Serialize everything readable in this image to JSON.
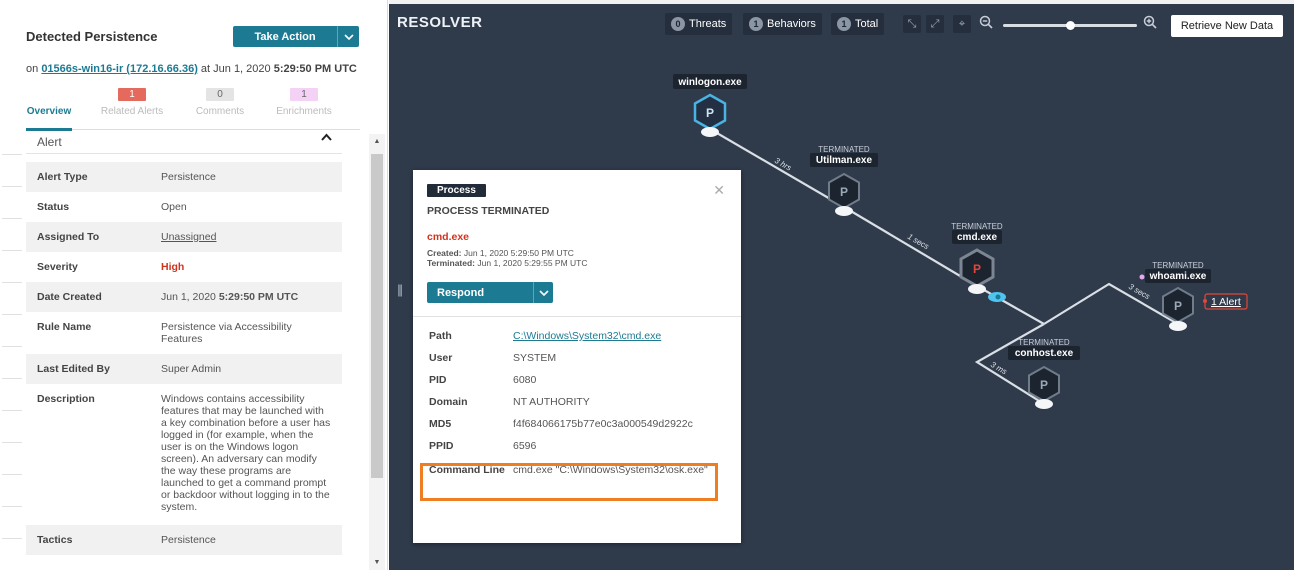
{
  "left_panel": {
    "title": "Detected Persistence",
    "take_action_label": "Take Action",
    "host_prefix": "on",
    "host_link": "01566s-win16-ir (172.16.66.36)",
    "host_at": "at Jun 1, 2020",
    "host_time": "5:29:50 PM UTC",
    "tabs": [
      {
        "label": "Overview",
        "badge": ""
      },
      {
        "label": "Related Alerts",
        "badge": "1"
      },
      {
        "label": "Comments",
        "badge": "0"
      },
      {
        "label": "Enrichments",
        "badge": "1"
      }
    ],
    "section_title": "Alert",
    "fields": {
      "alert_type": {
        "k": "Alert Type",
        "v": "Persistence"
      },
      "status": {
        "k": "Status",
        "v": "Open"
      },
      "assigned_to": {
        "k": "Assigned To",
        "v": "Unassigned"
      },
      "severity": {
        "k": "Severity",
        "v": "High"
      },
      "date_created": {
        "k": "Date Created",
        "v_date": "Jun 1, 2020",
        "v_time": "5:29:50 PM UTC"
      },
      "rule_name": {
        "k": "Rule Name",
        "v": "Persistence via Accessibility Features"
      },
      "last_edited_by": {
        "k": "Last Edited By",
        "v": "Super Admin"
      },
      "description": {
        "k": "Description",
        "v": "Windows contains accessibility features that may be launched with a key combination before a user has logged in (for example, when the user is on the Windows logon screen). An adversary can modify the way these programs are launched to get a command prompt or backdoor without logging in to the system."
      },
      "tactics": {
        "k": "Tactics",
        "v": "Persistence"
      }
    }
  },
  "toolbar": {
    "logo": "RESOLVER",
    "threats": {
      "count": "0",
      "label": "Threats"
    },
    "behaviors": {
      "count": "1",
      "label": "Behaviors"
    },
    "total": {
      "count": "1",
      "label": "Total"
    },
    "zoom_level": 0.5,
    "retrieve_label": "Retrieve New Data"
  },
  "graph": {
    "node_glyph": "P",
    "terminated_label": "TERMINATED",
    "nodes": {
      "winlogon": "winlogon.exe",
      "utilman": "Utilman.exe",
      "cmd": "cmd.exe",
      "conhost": "conhost.exe",
      "whoami": "whoami.exe"
    },
    "edges": {
      "e1": "3 hrs",
      "e2": "1 secs",
      "e3": "3 ms",
      "e4": "3 secs"
    },
    "alert_link": "1 Alert"
  },
  "card": {
    "tag": "Process",
    "state": "PROCESS TERMINATED",
    "process_name": "cmd.exe",
    "created_label": "Created:",
    "created": "Jun 1, 2020 5:29:50 PM UTC",
    "terminated_label": "Terminated:",
    "terminated": "Jun 1, 2020 5:29:55 PM UTC",
    "respond_label": "Respond",
    "props": {
      "path": {
        "k": "Path",
        "v": "C:\\Windows\\System32\\cmd.exe"
      },
      "user": {
        "k": "User",
        "v": "SYSTEM"
      },
      "pid": {
        "k": "PID",
        "v": "6080"
      },
      "domain": {
        "k": "Domain",
        "v": "NT AUTHORITY"
      },
      "md5": {
        "k": "MD5",
        "v": "f4f684066175b77e0c3a000549d2922c"
      },
      "ppid": {
        "k": "PPID",
        "v": "6596"
      },
      "command_line": {
        "k": "Command Line",
        "v": "cmd.exe \"C:\\Windows\\System32\\osk.exe\""
      }
    }
  }
}
